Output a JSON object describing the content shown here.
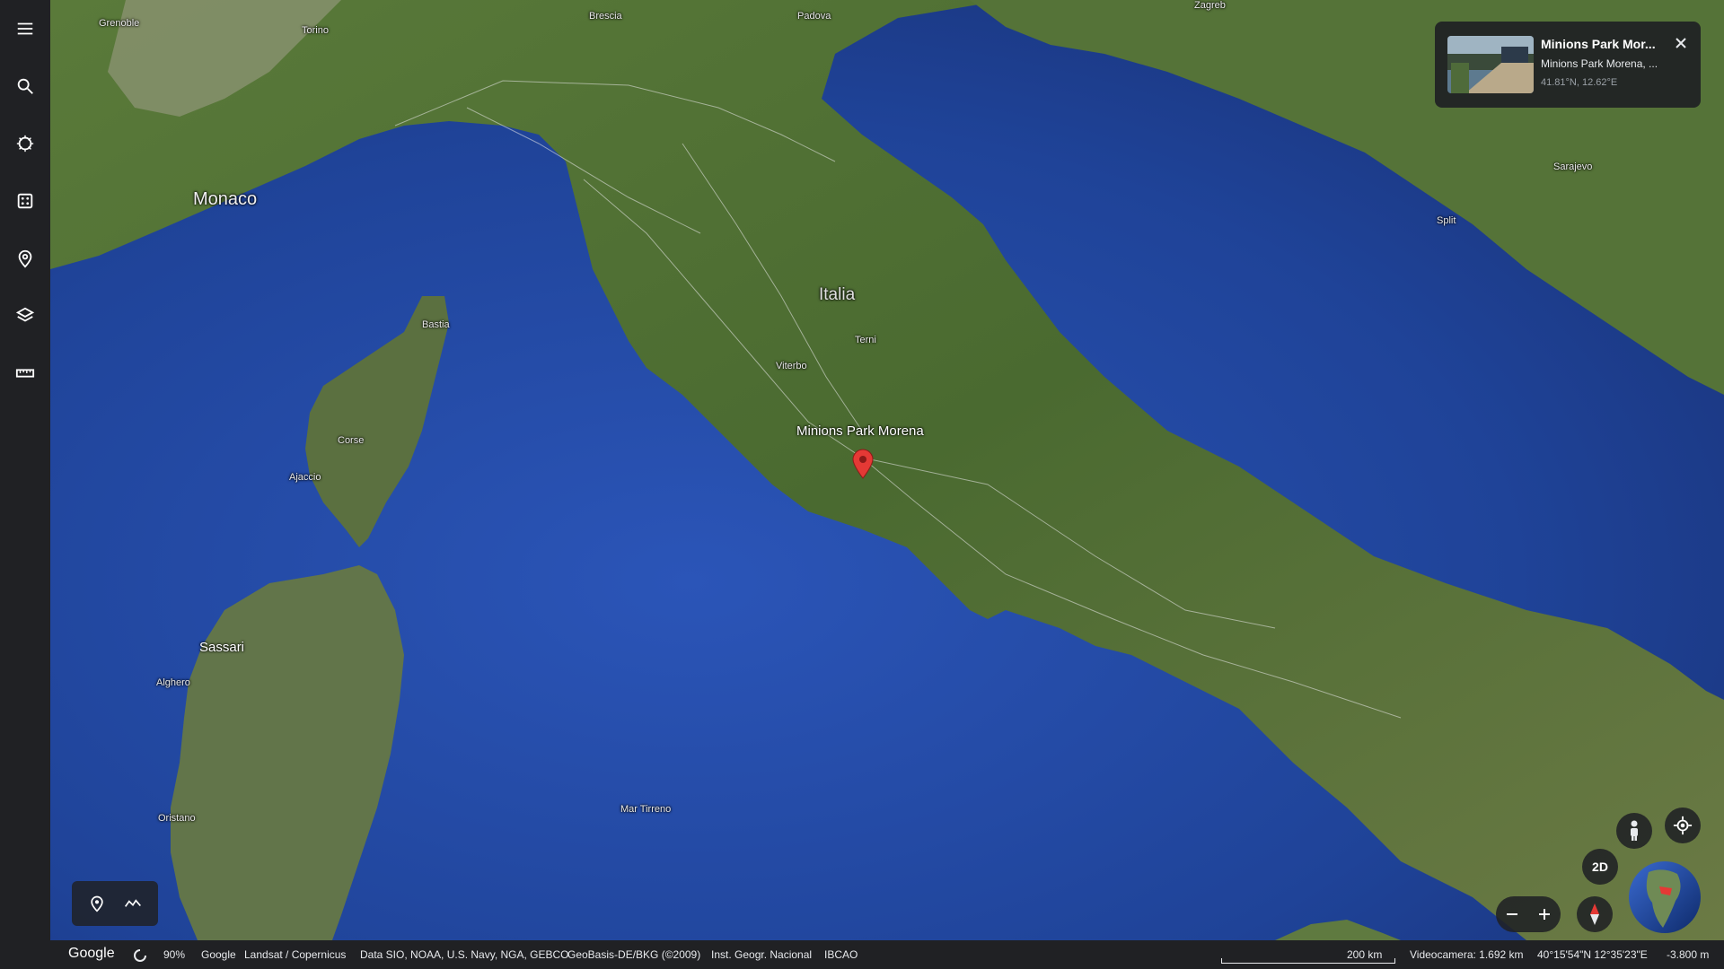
{
  "sidebar": {
    "items": [
      {
        "icon": "menu-icon"
      },
      {
        "icon": "search-icon"
      },
      {
        "icon": "voyager-icon"
      },
      {
        "icon": "random-dice-icon"
      },
      {
        "icon": "projects-pin-icon"
      },
      {
        "icon": "layers-icon"
      },
      {
        "icon": "ruler-icon"
      }
    ]
  },
  "map": {
    "labels": {
      "country_italia": "Italia",
      "monaco": "Monaco",
      "minions_park": "Minions Park Morena",
      "terni": "Terni",
      "viterbo": "Viterbo",
      "bastia": "Bastia",
      "corse": "Corse",
      "ajaccio": "Ajaccio",
      "sassari": "Sassari",
      "alghero": "Alghero",
      "oristano": "Oristano",
      "mar_tirreno": "Mar Tirreno",
      "grenoble": "Grenoble",
      "torino": "Torino",
      "brescia": "Brescia",
      "padova": "Padova",
      "zagreb": "Zagreb",
      "sarajevo": "Sarajevo",
      "split": "Split"
    }
  },
  "info_card": {
    "title": "Minions Park Mor...",
    "subtitle": "Minions Park Morena, ...",
    "coordinates": "41.81°N, 12.62°E"
  },
  "tools": {
    "placemark": "pin-icon",
    "path": "path-icon"
  },
  "controls": {
    "view_mode": "2D",
    "pegman": "pegman-icon",
    "my_location": "my-location-icon",
    "compass": "compass-icon"
  },
  "statusbar": {
    "logo": "Google",
    "progress_percent": "90%",
    "credits": [
      "Google",
      "Landsat / Copernicus",
      "Data SIO, NOAA, U.S. Navy, NGA, GEBCO",
      "GeoBasis-DE/BKG (©2009)",
      "Inst. Geogr. Nacional",
      "IBCAO"
    ],
    "scale": "200 km",
    "camera": "Videocamera: 1.692 km",
    "position": "40°15'54\"N 12°35'23\"E",
    "elevation": "-3.800 m"
  },
  "colors": {
    "sea": "#1e3f8f",
    "land": "#4d6b33",
    "panel": "#202124",
    "pin": "#e53935"
  }
}
